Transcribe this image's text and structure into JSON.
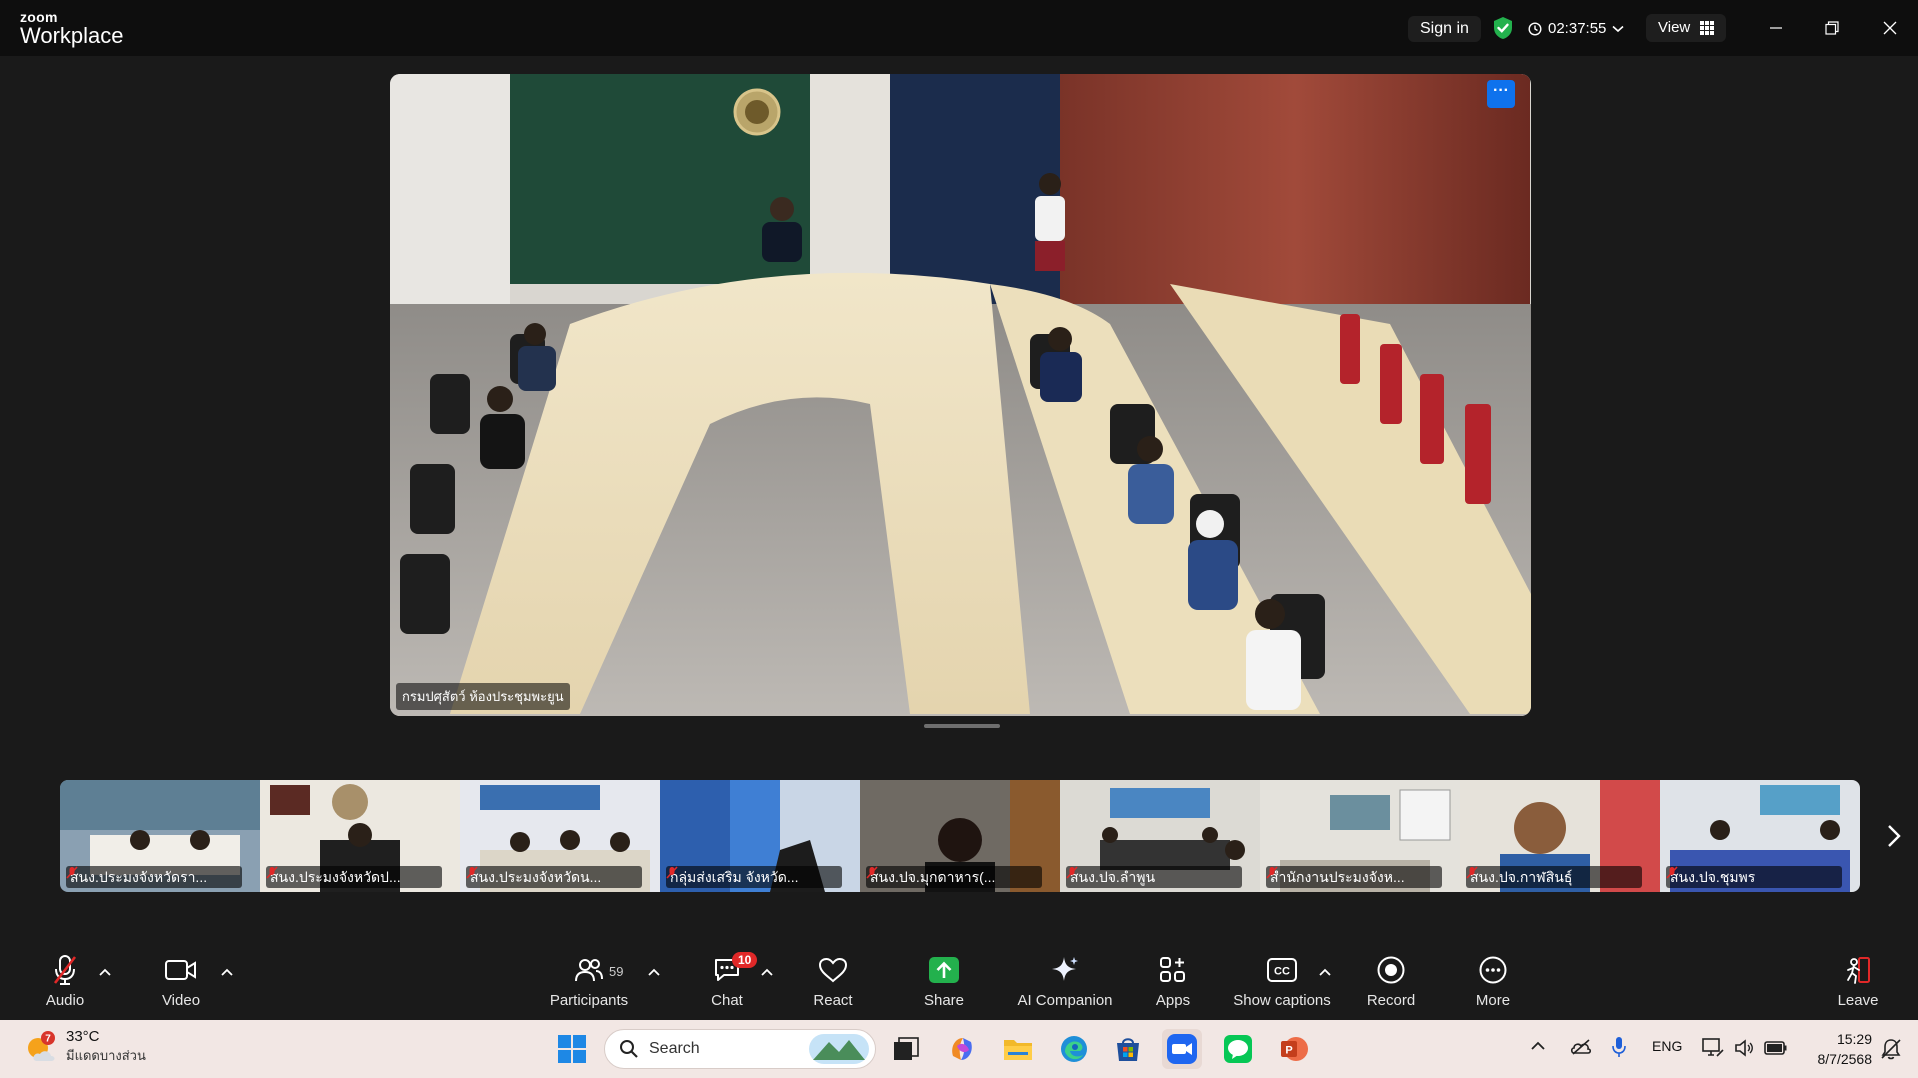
{
  "app": {
    "brand_top": "zoom",
    "brand_bottom": "Workplace",
    "sign_in": "Sign in",
    "timer": "02:37:55",
    "view": "View",
    "accent": "#0e72ed"
  },
  "main_video": {
    "name": "กรมปศุสัตว์ ห้องประชุมพะยูน",
    "more": "···"
  },
  "participants_strip": [
    {
      "name": "สนง.ประมงจังหวัดรา..."
    },
    {
      "name": "สนง.ประมงจังหวัดป..."
    },
    {
      "name": "สนง.ประมงจังหวัดน..."
    },
    {
      "name": "กลุ่มส่งเสริม จังหวัด..."
    },
    {
      "name": "สนง.ปจ.มุกดาหาร(..."
    },
    {
      "name": "สนง.ปจ.ลำพูน"
    },
    {
      "name": "สำนักงานประมงจังห..."
    },
    {
      "name": "สนง.ปจ.กาฬสินธุ์"
    },
    {
      "name": "สนง.ปจ.ชุมพร"
    }
  ],
  "toolbar": {
    "audio": "Audio",
    "video": "Video",
    "participants": "Participants",
    "participants_count": "59",
    "chat": "Chat",
    "chat_badge": "10",
    "react": "React",
    "share": "Share",
    "ai_companion": "AI Companion",
    "apps": "Apps",
    "show_captions": "Show captions",
    "record": "Record",
    "more": "More",
    "leave": "Leave"
  },
  "taskbar": {
    "weather_badge": "7",
    "temperature": "33°C",
    "weather_desc": "มีแดดบางส่วน",
    "search": "Search",
    "language": "ENG",
    "time": "15:29",
    "date": "8/7/2568"
  }
}
